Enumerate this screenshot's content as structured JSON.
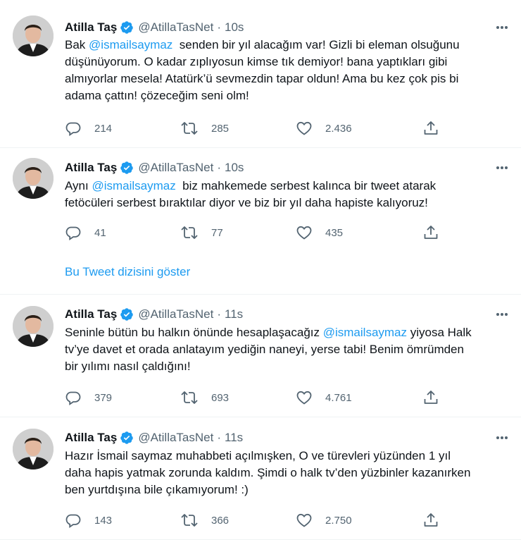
{
  "author": {
    "name": "Atilla Taş",
    "handle": "@AtillaTasNet",
    "dot": "·"
  },
  "tweets": [
    {
      "time": "10s",
      "lines": [
        [
          {
            "t": "Bak "
          },
          {
            "t": "@ismailsaymaz",
            "m": true
          },
          {
            "t": "  senden bir yıl alacağım var! Gizli bi eleman olsuğunu"
          }
        ],
        [
          {
            "t": "düşünüyorum. O kadar zıplıyosun kimse tık demiyor! bana yaptıkları gibi"
          }
        ],
        [
          {
            "t": "almıyorlar mesela! Atatürk’ü sevmezdin tapar oldun! Ama bu kez çok pis bi"
          }
        ],
        [
          {
            "t": "adama çattın! çözeceğim seni olm!"
          }
        ]
      ],
      "replies": "214",
      "retweets": "285",
      "likes": "2.436"
    },
    {
      "time": "10s",
      "lines": [
        [
          {
            "t": "Aynı "
          },
          {
            "t": "@ismailsaymaz",
            "m": true
          },
          {
            "t": "  biz mahkemede serbest kalınca bir tweet atarak"
          }
        ],
        [
          {
            "t": "fetöcüleri serbest bıraktılar diyor ve biz bir yıl daha hapiste kalıyoruz!"
          }
        ]
      ],
      "replies": "41",
      "retweets": "77",
      "likes": "435",
      "thread_link": "Bu Tweet dizisini göster"
    },
    {
      "time": "11s",
      "lines": [
        [
          {
            "t": "Seninle bütün bu halkın önünde hesaplaşacağız "
          },
          {
            "t": "@ismailsaymaz",
            "m": true
          },
          {
            "t": " yiyosa Halk"
          }
        ],
        [
          {
            "t": "tv’ye davet et orada anlatayım yediğin naneyi, yerse tabi! Benim ömrümden"
          }
        ],
        [
          {
            "t": "bir yılımı nasıl çaldığını!"
          }
        ]
      ],
      "replies": "379",
      "retweets": "693",
      "likes": "4.761"
    },
    {
      "time": "11s",
      "lines": [
        [
          {
            "t": "Hazır İsmail saymaz muhabbeti açılmışken, O ve türevleri yüzünden 1 yıl"
          }
        ],
        [
          {
            "t": "daha hapis yatmak zorunda kaldım. Şimdi o halk tv’den yüzbinler kazanırken"
          }
        ],
        [
          {
            "t": "ben yurtdışına bile çıkamıyorum! :)"
          }
        ]
      ],
      "replies": "143",
      "retweets": "366",
      "likes": "2.750"
    }
  ],
  "colors": {
    "accent": "#1d9bf0",
    "text": "#0f1419",
    "muted": "#536471",
    "divider": "#eff3f4"
  },
  "icons": {
    "reply": "reply-icon",
    "retweet": "retweet-icon",
    "like": "like-icon",
    "share": "share-icon",
    "more": "more-icon",
    "verified": "verified-badge-icon"
  }
}
